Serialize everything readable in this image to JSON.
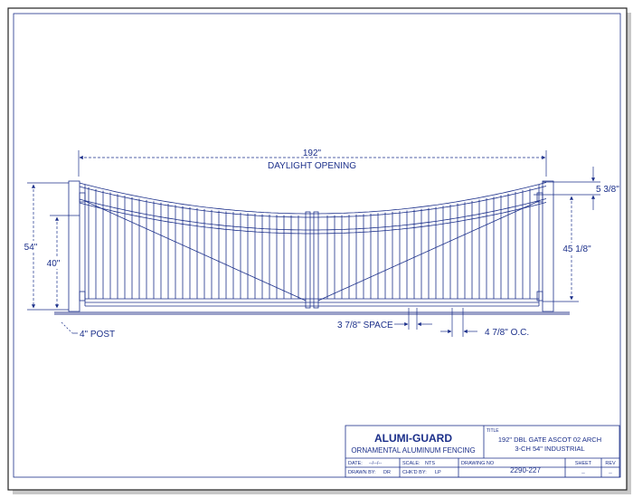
{
  "dimensions": {
    "width_192": "192\"",
    "daylight_opening": "DAYLIGHT OPENING",
    "height_54": "54\"",
    "height_40": "40\"",
    "post": "4\" POST",
    "space": "3 7/8\" SPACE",
    "oc": "4 7/8\" O.C.",
    "arch_rise": "5 3/8\"",
    "right_height": "45 1/8\""
  },
  "title_block": {
    "company": "ALUMI-GUARD",
    "company_sub": "ORNAMENTAL ALUMINUM FENCING",
    "title_label": "TITLE",
    "title_line1": "192\" DBL GATE ASCOT 02 ARCH",
    "title_line2": "3-CH 54\" INDUSTRIAL",
    "date_label": "DATE:",
    "date_value": "--/--/--",
    "scale_label": "SCALE:",
    "scale_value": "NTS",
    "drawing_no_label": "DRAWING NO",
    "drawing_no": "2290-227",
    "sheet_label": "SHEET",
    "sheet_value": "--",
    "rev_label": "REV",
    "rev_value": "--",
    "drawn_by_label": "DRAWN BY:",
    "drawn_by": "DR",
    "chkd_by_label": "CHK'D BY:",
    "chkd_by": "LP"
  },
  "colors": {
    "line": "#1b2f8a",
    "ground": "#9aa0c8",
    "shadow": "#b8b8b8"
  }
}
